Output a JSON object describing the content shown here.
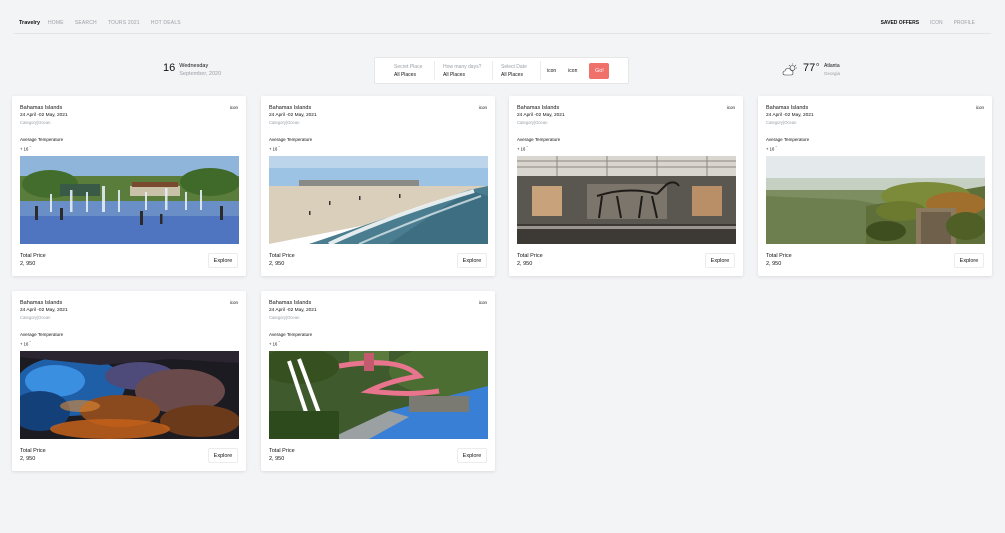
{
  "nav": {
    "brand": "Travelry",
    "left": [
      "HOME",
      "SEARCH",
      "TOURS 2021",
      "HOT DEALS"
    ],
    "right": [
      "SAVED OFFERS",
      "ICON",
      "PROFILE"
    ]
  },
  "date": {
    "day": "16",
    "weekday": "Wednesday",
    "month_year": "September, 2020"
  },
  "search": {
    "fields": [
      {
        "label": "Secret Place",
        "value": "All Places"
      },
      {
        "label": "How many days?",
        "value": "All Places"
      },
      {
        "label": "Select Date",
        "value": "All Places"
      }
    ],
    "icon1": "icon",
    "icon2": "icon",
    "go": "Go!"
  },
  "weather": {
    "temp": "77",
    "deg": "o",
    "city": "Atlanta",
    "state": "Georgia"
  },
  "cards": [
    {
      "title": "Bahamas Islands",
      "icon": "icon",
      "dates": "24 April -02 May, 2021",
      "category": "Category|Ocean",
      "avg_label": "Average Temperature",
      "avg_value": "+ 16",
      "avg_unit": "°",
      "price_label": "Total Price",
      "price": "2, 950",
      "button": "Explore"
    },
    {
      "title": "Bahamas Islands",
      "icon": "icon",
      "dates": "24 April -02 May, 2021",
      "category": "Category|Ocean",
      "avg_label": "Average Temperature",
      "avg_value": "+ 16",
      "avg_unit": "°",
      "price_label": "Total Price",
      "price": "2, 950",
      "button": "Explore"
    },
    {
      "title": "Bahamas Islands",
      "icon": "icon",
      "dates": "24 April -02 May, 2021",
      "category": "Category|Ocean",
      "avg_label": "Average Temperature",
      "avg_value": "+ 16",
      "avg_unit": "°",
      "price_label": "Total Price",
      "price": "2, 950",
      "button": "Explore"
    },
    {
      "title": "Bahamas Islands",
      "icon": "icon",
      "dates": "24 April -02 May, 2021",
      "category": "Category|Ocean",
      "avg_label": "Average Temperature",
      "avg_value": "+ 16",
      "avg_unit": "°",
      "price_label": "Total Price",
      "price": "2, 950",
      "button": "Explore"
    },
    {
      "title": "Bahamas Islands",
      "icon": "icon",
      "dates": "24 April -02 May, 2021",
      "category": "Category|Ocean",
      "avg_label": "Average Temperature",
      "avg_value": "+ 16",
      "avg_unit": "°",
      "price_label": "Total Price",
      "price": "2, 950",
      "button": "Explore"
    },
    {
      "title": "Bahamas Islands",
      "icon": "icon",
      "dates": "24 April -02 May, 2021",
      "category": "Category|Ocean",
      "avg_label": "Average Temperature",
      "avg_value": "+ 16",
      "avg_unit": "°",
      "price_label": "Total Price",
      "price": "2, 950",
      "button": "Explore"
    }
  ],
  "colors": {
    "accent": "#f0706a",
    "muted": "#9aa0a6",
    "background": "#f3f4f6"
  }
}
